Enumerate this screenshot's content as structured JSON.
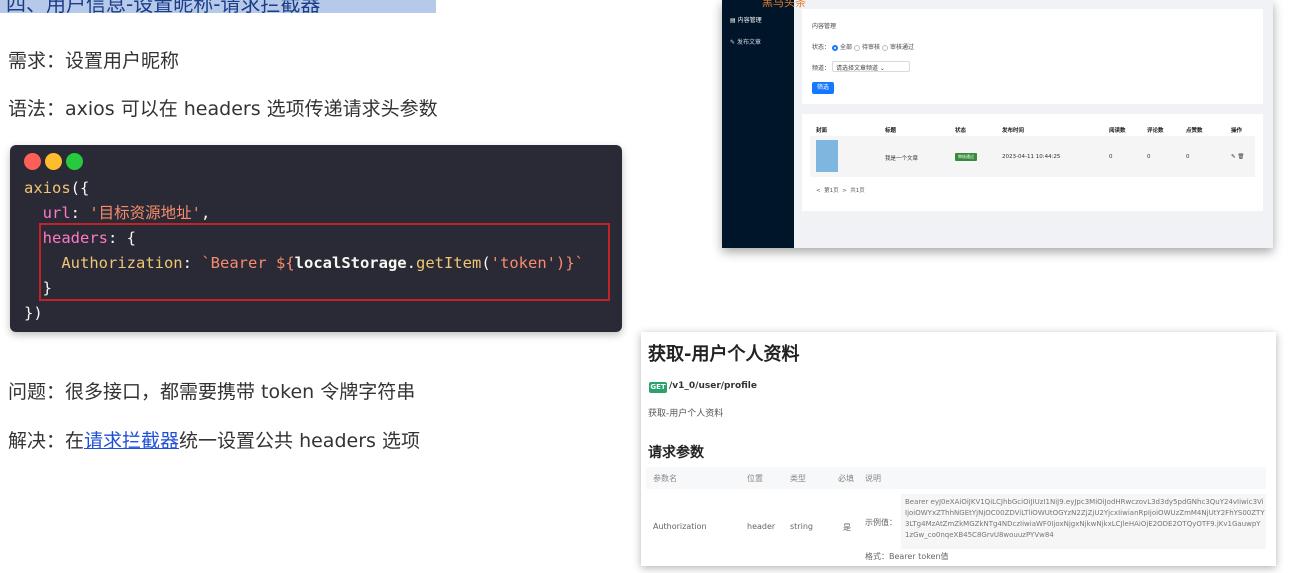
{
  "heading": {
    "text": "四、用户信息-设置昵称-请求拦截器"
  },
  "left": {
    "demand": "需求：设置用户昵称",
    "syntax": "语法：axios 可以在 headers 选项传递请求头参数",
    "problem": "问题：很多接口，都需要携带 token 令牌字符串",
    "solution_prefix": "解决：在",
    "solution_link": "请求拦截器",
    "solution_suffix": "统一设置公共 headers 选项"
  },
  "code": {
    "line1_fn": "axios",
    "line1_rest": "({",
    "url_key": "url",
    "url_value": "'目标资源地址'",
    "headers_key": "headers",
    "auth_key": "Authorization",
    "auth_prefix": "`Bearer ${",
    "auth_obj": "localStorage",
    "auth_method": "getItem",
    "auth_arg": "'token'",
    "auth_suffix": ")}`",
    "close_inner": "}",
    "close_outer": "})"
  },
  "admin": {
    "logo": "黑马头条",
    "nav_items": [
      "内容管理",
      "发布文章"
    ],
    "card_title": "内容管理",
    "status_label": "状态：",
    "status_options": [
      "全部",
      "待审核",
      "审核通过"
    ],
    "channel_label": "频道：",
    "channel_select": "请选择文章频道",
    "filter_button": "筛选",
    "table_headers": [
      "封面",
      "标题",
      "状态",
      "发布时间",
      "阅读数",
      "评论数",
      "点赞数",
      "操作"
    ],
    "row": {
      "title": "我是一个文章",
      "status": "审核通过",
      "time": "2023-04-11 10:44:25",
      "reads": "0",
      "comments": "0",
      "likes": "0"
    },
    "pager": {
      "prev": "<",
      "page": "第1页",
      "next": ">",
      "total": "共1页"
    }
  },
  "api": {
    "title": "获取-用户个人资料",
    "method": "GET",
    "endpoint": "/v1_0/user/profile",
    "description": "获取-用户个人资料",
    "section": "请求参数",
    "headers": [
      "参数名",
      "位置",
      "类型",
      "必填",
      "说明"
    ],
    "row": {
      "name": "Authorization",
      "position": "header",
      "type": "string",
      "required": "是",
      "example_label": "示例值：",
      "example": "Bearer eyJ0eXAiOiJKV1QiLCJhbGciOiJIUzI1NiJ9.eyJpc3MiOiJodHRwczovL3d3dy5pdGNhc3QuY24vIiwic3ViIjoiOWYxZThhNGEtYjNjOC00ZDViLTliOWUtOGYzN2ZjZjU2YjcxIiwianRpIjoiOWUzZmM4NjUtY2FhYS00ZTY3LTg4MzAtZmZkMGZkNTg4NDczIiwiaWF0IjoxNjgxNjkwNjkxLCJleHAiOjE2ODE2OTQyOTF9.jKv1GauwpY1zGw_co0nqeXB45C8GrvU8wouuzPYVw84",
      "format": "格式：Bearer token值"
    }
  }
}
